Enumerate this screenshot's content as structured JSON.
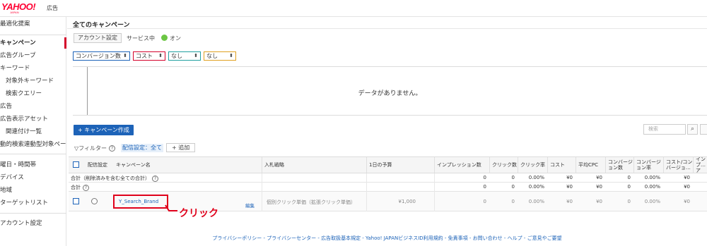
{
  "header": {
    "logo_text": "YAHOO!",
    "logo_sub": "JAPAN",
    "ad_label": "広告"
  },
  "sidebar": {
    "items": [
      {
        "label": "最適化提案",
        "sub": false,
        "active": false
      },
      {
        "label": "キャンペーン",
        "sub": false,
        "active": true
      },
      {
        "label": "広告グループ",
        "sub": false,
        "active": false
      },
      {
        "label": "キーワード",
        "sub": false,
        "active": false
      },
      {
        "label": "対象外キーワード",
        "sub": true,
        "active": false
      },
      {
        "label": "検索クエリー",
        "sub": true,
        "active": false
      },
      {
        "label": "広告",
        "sub": false,
        "active": false
      },
      {
        "label": "広告表示アセット",
        "sub": false,
        "active": false
      },
      {
        "label": "関連付け一覧",
        "sub": true,
        "active": false
      },
      {
        "label": "動的検索連動型対象ページ",
        "sub": false,
        "active": false
      },
      {
        "label": "曜日・時間帯",
        "sub": false,
        "active": false
      },
      {
        "label": "デバイス",
        "sub": false,
        "active": false
      },
      {
        "label": "地域",
        "sub": false,
        "active": false
      },
      {
        "label": "ターゲットリスト",
        "sub": false,
        "active": false
      },
      {
        "label": "アカウント設定",
        "sub": false,
        "active": false
      }
    ]
  },
  "main": {
    "title": "全てのキャンペーン",
    "account_settings_button": "アカウント設定",
    "service_label": "サービス中",
    "service_status": "オン",
    "selectors": [
      {
        "label": "コンバージョン数",
        "color": "#1d63b8"
      },
      {
        "label": "コスト",
        "color": "#d4002a"
      },
      {
        "label": "なし",
        "color": "#20a0a0"
      },
      {
        "label": "なし",
        "color": "#e0a020"
      }
    ],
    "no_data_text": "データがありません。",
    "create_button": "+ キャンペーン作成",
    "search_placeholder": "検索",
    "search_icon": "search-icon",
    "filter_label": "▽フィルター",
    "filter_tag": "配信設定：全て",
    "add_button": "+ 追加"
  },
  "table": {
    "headers": [
      "配信設定",
      "キャンペーン名",
      "入札戦略",
      "1日の予算",
      "インプレッション数",
      "クリック数",
      "クリック率",
      "コスト",
      "平均CPC",
      "コンバージョン数",
      "コンバージョン率",
      "コスト/コンバージョ…",
      "インプ…ア"
    ],
    "total_all_label": "合計（削除済みを含む全ての合計）",
    "total_label": "合計",
    "summary_values": [
      "0",
      "0",
      "0.00%",
      "¥0",
      "¥0",
      "0",
      "0.00%",
      "¥0"
    ],
    "campaign": {
      "name": "Y_Search_Brand",
      "edit_label": "編集",
      "bid_strategy": "個別クリック単価（拡張クリック単価）",
      "budget": "¥1,000",
      "values": [
        "0",
        "0",
        "0.00%",
        "¥0",
        "¥0",
        "0",
        "0.00%",
        "¥0"
      ]
    }
  },
  "annotation": {
    "text": "クリック",
    "color": "#e0001b"
  },
  "footer": {
    "links": "プライバシーポリシー - プライバシーセンター - 広告取扱基本規定 - Yahoo! JAPANビジネスID利用規約 - 免責事項 - お問い合わせ - ヘルプ - ご意見やご要望"
  }
}
